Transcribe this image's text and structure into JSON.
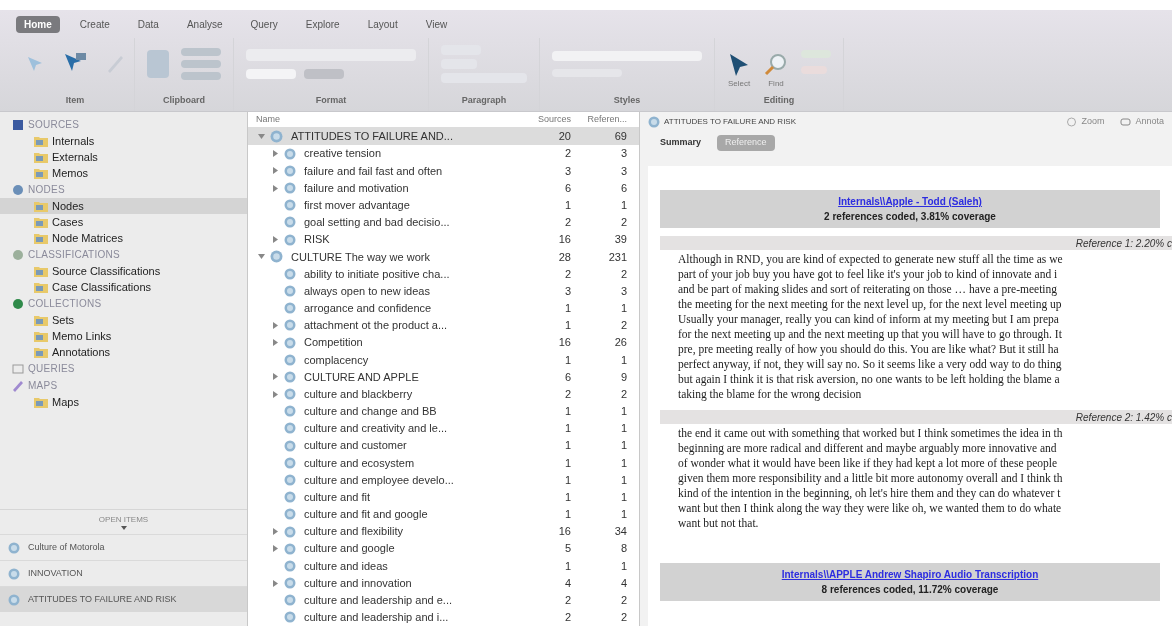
{
  "ribbon": {
    "tabs": [
      {
        "label": "Home",
        "selected": true
      },
      {
        "label": "Create",
        "selected": false
      },
      {
        "label": "Data",
        "selected": false
      },
      {
        "label": "Analyse",
        "selected": false
      },
      {
        "label": "Query",
        "selected": false
      },
      {
        "label": "Explore",
        "selected": false
      },
      {
        "label": "Layout",
        "selected": false
      },
      {
        "label": "View",
        "selected": false
      }
    ],
    "groups": [
      {
        "kind": "item",
        "label": "Item"
      },
      {
        "kind": "clipboard",
        "label": "Clipboard"
      },
      {
        "kind": "format",
        "label": "Format"
      },
      {
        "kind": "paragraph",
        "label": "Paragraph"
      },
      {
        "kind": "styles",
        "label": "Styles"
      },
      {
        "kind": "editing",
        "label": "Editing",
        "buttons": [
          "Select",
          "Find"
        ]
      }
    ]
  },
  "sidebar": {
    "sections": [
      {
        "kind": "sources",
        "title": "SOURCES",
        "items": [
          {
            "label": "Internals",
            "selected": false
          },
          {
            "label": "Externals",
            "selected": false
          },
          {
            "label": "Memos",
            "selected": false
          }
        ]
      },
      {
        "kind": "nodes",
        "title": "NODES",
        "items": [
          {
            "label": "Nodes",
            "selected": true
          },
          {
            "label": "Cases",
            "selected": false
          },
          {
            "label": "Node Matrices",
            "selected": false
          }
        ]
      },
      {
        "kind": "classifications",
        "title": "CLASSIFICATIONS",
        "items": [
          {
            "label": "Source Classifications",
            "selected": false
          },
          {
            "label": "Case Classifications",
            "selected": false
          }
        ]
      },
      {
        "kind": "collections",
        "title": "COLLECTIONS",
        "items": [
          {
            "label": "Sets",
            "selected": false
          },
          {
            "label": "Memo Links",
            "selected": false
          },
          {
            "label": "Annotations",
            "selected": false
          }
        ]
      },
      {
        "kind": "queries",
        "title": "QUERIES"
      },
      {
        "kind": "maps",
        "title": "MAPS",
        "items": [
          {
            "label": "Maps",
            "selected": false
          }
        ]
      }
    ],
    "open_items_title": "OPEN ITEMS",
    "open_items": [
      {
        "label": "Culture of Motorola",
        "selected": false
      },
      {
        "label": "INNOVATION",
        "selected": false
      },
      {
        "label": "ATTITUDES TO FAILURE AND RISK",
        "selected": true
      }
    ]
  },
  "node_list": {
    "columns": [
      "Name",
      "Sources",
      "Referen..."
    ],
    "nodes": [
      {
        "name": "ATTITUDES TO FAILURE AND...",
        "sources": "20",
        "references": "69",
        "expanded": true,
        "selected": true,
        "children": [
          {
            "name": "creative tension",
            "sources": "2",
            "references": "3",
            "expandable": true
          },
          {
            "name": "failure and fail fast and often",
            "sources": "3",
            "references": "3",
            "expandable": true
          },
          {
            "name": "failure and motivation",
            "sources": "6",
            "references": "6",
            "expandable": true
          },
          {
            "name": "first mover advantage",
            "sources": "1",
            "references": "1",
            "expandable": false
          },
          {
            "name": "goal setting and bad decisio...",
            "sources": "2",
            "references": "2",
            "expandable": false
          },
          {
            "name": "RISK",
            "sources": "16",
            "references": "39",
            "expandable": true
          }
        ]
      },
      {
        "name": "CULTURE The way we work",
        "sources": "28",
        "references": "231",
        "expanded": true,
        "selected": false,
        "children": [
          {
            "name": "ability to initiate positive cha...",
            "sources": "2",
            "references": "2",
            "expandable": false
          },
          {
            "name": "always open to new ideas",
            "sources": "3",
            "references": "3",
            "expandable": false
          },
          {
            "name": "arrogance and confidence",
            "sources": "1",
            "references": "1",
            "expandable": false
          },
          {
            "name": "attachment ot the product a...",
            "sources": "1",
            "references": "2",
            "expandable": true
          },
          {
            "name": "Competition",
            "sources": "16",
            "references": "26",
            "expandable": true
          },
          {
            "name": "complacency",
            "sources": "1",
            "references": "1",
            "expandable": false
          },
          {
            "name": "CULTURE AND APPLE",
            "sources": "6",
            "references": "9",
            "expandable": true
          },
          {
            "name": "culture and blackberry",
            "sources": "2",
            "references": "2",
            "expandable": true
          },
          {
            "name": "culture and change and BB",
            "sources": "1",
            "references": "1",
            "expandable": false
          },
          {
            "name": "culture and creativity and le...",
            "sources": "1",
            "references": "1",
            "expandable": false
          },
          {
            "name": "culture and customer",
            "sources": "1",
            "references": "1",
            "expandable": false
          },
          {
            "name": "culture and ecosystem",
            "sources": "1",
            "references": "1",
            "expandable": false
          },
          {
            "name": "culture and employee develo...",
            "sources": "1",
            "references": "1",
            "expandable": false
          },
          {
            "name": "culture and fit",
            "sources": "1",
            "references": "1",
            "expandable": false
          },
          {
            "name": "culture and fit and google",
            "sources": "1",
            "references": "1",
            "expandable": false
          },
          {
            "name": "culture and flexibility",
            "sources": "16",
            "references": "34",
            "expandable": true
          },
          {
            "name": "culture and google",
            "sources": "5",
            "references": "8",
            "expandable": true
          },
          {
            "name": "culture and ideas",
            "sources": "1",
            "references": "1",
            "expandable": false
          },
          {
            "name": "culture and innovation",
            "sources": "4",
            "references": "4",
            "expandable": true
          },
          {
            "name": "culture and leadership and e...",
            "sources": "2",
            "references": "2",
            "expandable": false
          },
          {
            "name": "culture and leadership and i...",
            "sources": "2",
            "references": "2",
            "expandable": false
          }
        ]
      }
    ]
  },
  "detail": {
    "title": "ATTITUDES TO FAILURE AND RISK",
    "actions": [
      "Zoom",
      "Annota"
    ],
    "tabs": [
      {
        "label": "Summary",
        "selected": false
      },
      {
        "label": "Reference",
        "selected": true
      }
    ],
    "sources": [
      {
        "link": "Internals\\\\Apple - Todd (Saleh)",
        "summary": "2 references coded, 3.81% coverage",
        "references": [
          {
            "heading": "Reference 1: 2.20% c",
            "lines": [
              "Although in RND, you are kind of expected to generate new stuff all the time as we",
              "part of your job buy you have got to feel like it's your job to kind of innovate and i",
              "and be part of making slides and sort of reiterating on those … have a pre-meeting",
              "the meeting for the next meeting for the next level up, for the next level meeting up",
              "Usually your manager, really you can kind of inform at my meeting but I am prepa",
              "for the next meeting up and the next meeting up that you will have to go through. It",
              "pre, pre meeting really of how you should do this. You are like what? But it still ha",
              "perfect anyway, if not, they will say no. So it seems like a very odd way to do thing",
              "but again I think it is that risk aversion, no one wants to be left holding the blame a",
              "taking the blame for the wrong decision"
            ]
          },
          {
            "heading": "Reference 2: 1.42% c",
            "lines": [
              "the end it came out with something that worked but I think sometimes the idea in th",
              "beginning are more radical and different and maybe arguably more innovative and",
              "of wonder what it would have been like if they had kept a lot more of these people",
              "given them more responsibility and a little bit more autonomy overall and I think th",
              "kind of the intention in the beginning, oh let's hire them and they can do whatever t",
              "want but then I think along the way they were like oh, we wanted them to do whate",
              "want but not that."
            ]
          }
        ]
      },
      {
        "link": "Internals\\\\APPLE Andrew Shapiro Audio Transcription",
        "summary": "8 references coded, 11.72% coverage"
      }
    ]
  }
}
